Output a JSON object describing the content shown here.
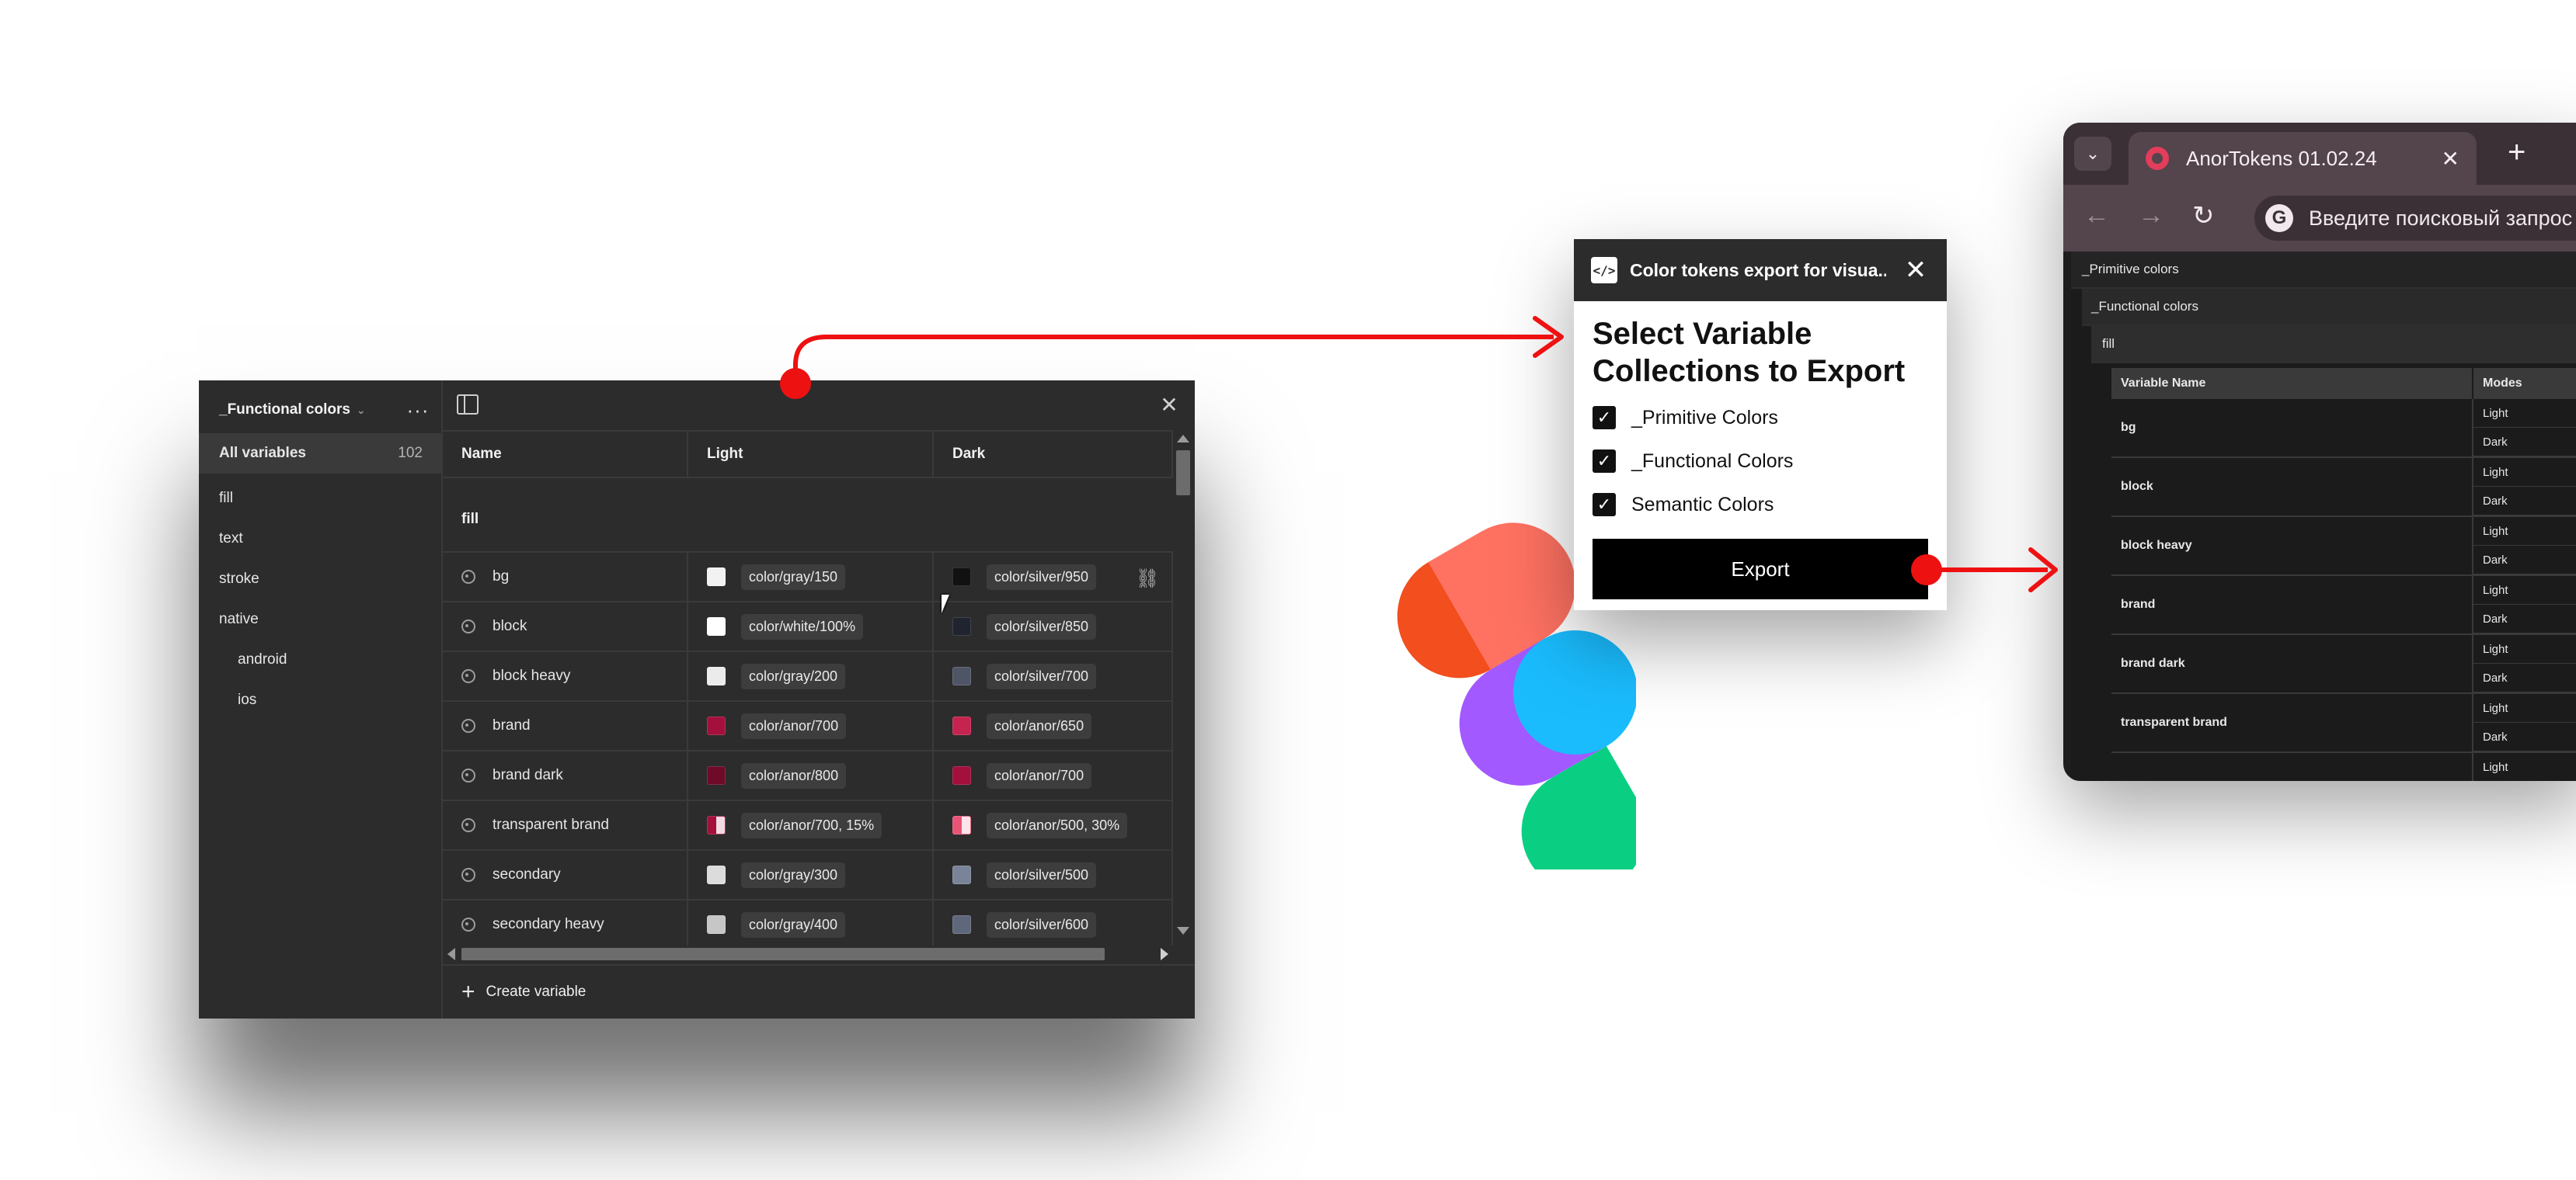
{
  "variables_panel": {
    "collection": "_Functional colors",
    "all_variables_label": "All variables",
    "all_variables_count": "102",
    "groups": [
      "fill",
      "text",
      "stroke",
      "native",
      "android",
      "ios"
    ],
    "columns": {
      "name": "Name",
      "light": "Light",
      "dark": "Dark"
    },
    "group_heading": "fill",
    "rows": [
      {
        "name": "bg",
        "light": "color/gray/150",
        "dark": "color/silver/950",
        "light_color": "#f2f2f2",
        "dark_color": "#111111"
      },
      {
        "name": "block",
        "light": "color/white/100%",
        "dark": "color/silver/850",
        "light_color": "#ffffff",
        "dark_color": "#1f2430"
      },
      {
        "name": "block heavy",
        "light": "color/gray/200",
        "dark": "color/silver/700",
        "light_color": "#ebebeb",
        "dark_color": "#4d5566"
      },
      {
        "name": "brand",
        "light": "color/anor/700",
        "dark": "color/anor/650",
        "light_color": "#a3103c",
        "dark_color": "#c4244f"
      },
      {
        "name": "brand dark",
        "light": "color/anor/800",
        "dark": "color/anor/700",
        "light_color": "#6d0b29",
        "dark_color": "#a3103c"
      },
      {
        "name": "transparent brand",
        "light": "color/anor/700, 15%",
        "dark": "color/anor/500, 30%",
        "light_color": "#a3103c",
        "dark_color": "#e85476"
      },
      {
        "name": "secondary",
        "light": "color/gray/300",
        "dark": "color/silver/500",
        "light_color": "#dcdcdc",
        "dark_color": "#7a8499"
      },
      {
        "name": "secondary heavy",
        "light": "color/gray/400",
        "dark": "color/silver/600",
        "light_color": "#c6c6c6",
        "dark_color": "#5f687b"
      }
    ],
    "create_label": "Create variable"
  },
  "plugin": {
    "title": "Color tokens export for visua...",
    "heading": "Select Variable Collections to Export",
    "options": [
      {
        "label": "_Primitive Colors",
        "checked": true
      },
      {
        "label": "_Functional Colors",
        "checked": true
      },
      {
        "label": "Semantic Colors",
        "checked": true
      }
    ],
    "export_label": "Export"
  },
  "browser": {
    "tab_title": "AnorTokens 01.02.24",
    "omnibox_placeholder": "Введите поисковый запрос",
    "sections": [
      "_Primitive colors",
      "_Functional colors",
      "fill"
    ],
    "table_headers": {
      "name": "Variable Name",
      "modes": "Modes"
    },
    "rows": [
      {
        "name": "bg",
        "modes": [
          "Light",
          "Dark"
        ]
      },
      {
        "name": "block",
        "modes": [
          "Light",
          "Dark"
        ]
      },
      {
        "name": "block heavy",
        "modes": [
          "Light",
          "Dark"
        ]
      },
      {
        "name": "brand",
        "modes": [
          "Light",
          "Dark"
        ]
      },
      {
        "name": "brand dark",
        "modes": [
          "Light",
          "Dark"
        ]
      },
      {
        "name": "transparent brand",
        "modes": [
          "Light",
          "Dark"
        ]
      }
    ],
    "partial_row_mode": "Light"
  },
  "colors": {
    "connector": "#ee1111",
    "figma_red": "#f24e1e",
    "figma_orange": "#ff7262",
    "figma_purple": "#a259ff",
    "figma_blue": "#1abcfe",
    "figma_green": "#0acf83"
  },
  "icons": [
    "sidebar-toggle-icon",
    "close-icon",
    "more-icon",
    "palette-icon",
    "link-icon",
    "plus-icon",
    "code-icon",
    "checkbox-icon",
    "chevron-down-icon",
    "back-icon",
    "forward-icon",
    "reload-icon",
    "google-icon"
  ]
}
